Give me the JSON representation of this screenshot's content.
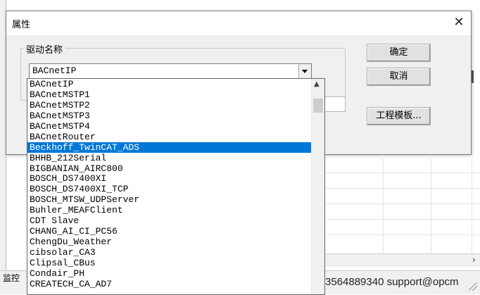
{
  "background": {
    "status_left": "监控",
    "status_right": "3564889340 support@opcm",
    "scroll_right_arrow": "›"
  },
  "dialog": {
    "title": "属性",
    "close_glyph": "✕",
    "group_label": "驱动名称",
    "combo_value": "BACnetIP",
    "buttons": {
      "ok": "确定",
      "cancel": "取消",
      "template": "工程模板..."
    }
  },
  "dropdown": {
    "selected_index": 7,
    "items": [
      "BACnetIP",
      "BACnetMSTP1",
      "BACnetMSTP2",
      "BACnetMSTP3",
      "BACnetMSTP4",
      "BACnetRouter",
      "Beckhoff_TwinCAT_ADS",
      "BHHB_212Serial",
      "BIGBANIAN_AIRC800",
      "BOSCH_DS7400XI",
      "BOSCH_DS7400XI_TCP",
      "BOSCH_MTSW_UDPServer",
      "Buhler_MEAFClient",
      "CDT Slave",
      "CHANG_AI_CI_PC56",
      "ChengDu_Weather",
      "cibsolar_CA3",
      "Clipsal_CBus",
      "Condair_PH",
      "CREATECH_CA_AD7"
    ],
    "scroll_up_glyph": "▲"
  },
  "colors": {
    "selection": "#0078d7",
    "dialog_bg": "#f0f0f0"
  }
}
